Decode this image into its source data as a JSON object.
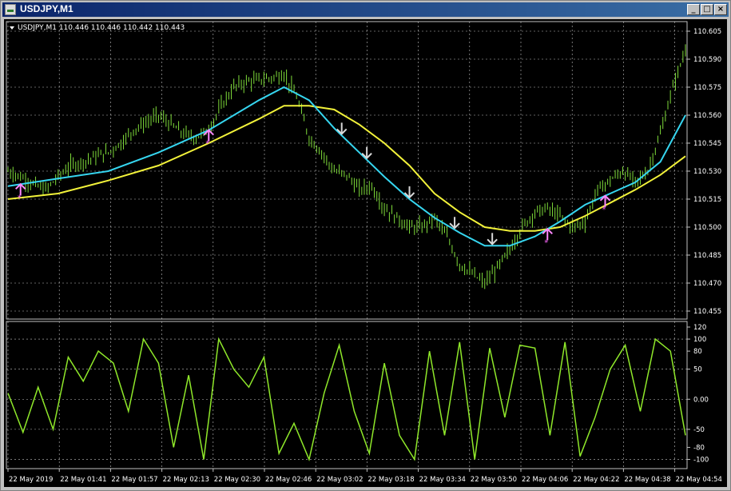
{
  "window": {
    "title": "USDJPY,M1",
    "buttons": {
      "minimize": "_",
      "maximize": "□",
      "close": "×"
    }
  },
  "main_panel": {
    "header": "USDJPY,M1  110.446 110.446 110.442 110.443",
    "price_ticks": [
      "110.605",
      "110.590",
      "110.575",
      "110.560",
      "110.545",
      "110.530",
      "110.515",
      "110.500",
      "110.485",
      "110.470",
      "110.455"
    ]
  },
  "sub_panel": {
    "ticks": [
      "120",
      "100",
      "80",
      "50",
      "0.00",
      "-50",
      "-80",
      "-100"
    ]
  },
  "time_labels": [
    "22 May 2019",
    "22 May 01:41",
    "22 May 01:57",
    "22 May 02:13",
    "22 May 02:30",
    "22 May 02:46",
    "22 May 03:02",
    "22 May 03:18",
    "22 May 03:34",
    "22 May 03:50",
    "22 May 04:06",
    "22 May 04:22",
    "22 May 04:38",
    "22 May 04:54"
  ],
  "colors": {
    "background": "#000000",
    "grid": "#c0c0c0",
    "candles": "#7fdc3a",
    "fast_ma": "#36d6f0",
    "slow_ma": "#f2f23a",
    "oscillator": "#8fe82a",
    "arrow_up": "#ff88ff",
    "arrow_down": "#d8d8d8",
    "star": "#ff66ff"
  },
  "chart_data": [
    {
      "type": "line",
      "title": "",
      "ylim": [
        110.455,
        110.605
      ],
      "series": [
        {
          "x_index": [
            0,
            5,
            10,
            15,
            20,
            25,
            30,
            35,
            40,
            45,
            50,
            55,
            60,
            65,
            70,
            75,
            80,
            85,
            90,
            95,
            100,
            105,
            110,
            115,
            120,
            125,
            130,
            135,
            140,
            145,
            150,
            155,
            160,
            165,
            170,
            175,
            180,
            185,
            190,
            195,
            200,
            205,
            210,
            215,
            220,
            225,
            230,
            235,
            240,
            245,
            250,
            255,
            260,
            265,
            270
          ],
          "values": [
            110.53,
            110.527,
            110.523,
            110.52,
            110.527,
            110.533,
            110.535,
            110.538,
            110.54,
            110.545,
            110.552,
            110.556,
            110.56,
            110.555,
            110.55,
            110.548,
            110.552,
            110.565,
            110.575,
            110.578,
            110.579,
            110.58,
            110.582,
            110.57,
            110.548,
            110.54,
            110.53,
            110.528,
            110.52,
            110.522,
            110.51,
            110.505,
            110.5,
            110.5,
            110.505,
            110.495,
            110.48,
            110.475,
            110.47,
            110.478,
            110.488,
            110.5,
            110.508,
            110.51,
            110.506,
            110.5,
            110.503,
            110.52,
            110.525,
            110.53,
            110.524,
            110.53,
            110.55,
            110.575,
            110.595
          ]
        },
        {
          "x_index": [
            0,
            20,
            40,
            60,
            80,
            100,
            110,
            120,
            130,
            140,
            150,
            160,
            170,
            180,
            190,
            200,
            210,
            220,
            230,
            240,
            250,
            260,
            270
          ],
          "values": [
            110.522,
            110.526,
            110.53,
            110.54,
            110.552,
            110.568,
            110.575,
            110.568,
            110.553,
            110.54,
            110.527,
            110.515,
            110.505,
            110.497,
            110.49,
            110.49,
            110.495,
            110.503,
            110.512,
            110.518,
            110.524,
            110.535,
            110.56
          ]
        },
        {
          "x_index": [
            0,
            20,
            40,
            60,
            80,
            100,
            110,
            120,
            130,
            140,
            150,
            160,
            170,
            180,
            190,
            200,
            210,
            220,
            230,
            240,
            250,
            260,
            270
          ],
          "values": [
            110.515,
            110.518,
            110.525,
            110.533,
            110.545,
            110.558,
            110.565,
            110.565,
            110.563,
            110.555,
            110.545,
            110.533,
            110.518,
            110.508,
            110.5,
            110.498,
            110.498,
            110.5,
            110.506,
            110.513,
            110.52,
            110.528,
            110.538
          ]
        }
      ]
    },
    {
      "type": "line",
      "title": "",
      "ylim": [
        -110,
        120
      ],
      "series": [
        {
          "x_index": [
            0,
            6,
            12,
            18,
            24,
            30,
            36,
            42,
            48,
            54,
            60,
            66,
            72,
            78,
            84,
            90,
            96,
            102,
            108,
            114,
            120,
            126,
            132,
            138,
            144,
            150,
            156,
            162,
            168,
            174,
            180,
            186,
            192,
            198,
            204,
            210,
            216,
            222,
            228,
            234,
            240,
            246,
            252,
            258,
            264,
            270
          ],
          "values": [
            10,
            -55,
            20,
            -50,
            70,
            30,
            80,
            60,
            -20,
            100,
            60,
            -80,
            40,
            -100,
            100,
            50,
            20,
            70,
            -90,
            -40,
            -100,
            10,
            90,
            -20,
            -90,
            60,
            -60,
            -100,
            80,
            -60,
            95,
            -100,
            85,
            -30,
            90,
            85,
            -60,
            95,
            -95,
            -30,
            50,
            90,
            -20,
            100,
            80,
            -60
          ]
        }
      ]
    }
  ]
}
